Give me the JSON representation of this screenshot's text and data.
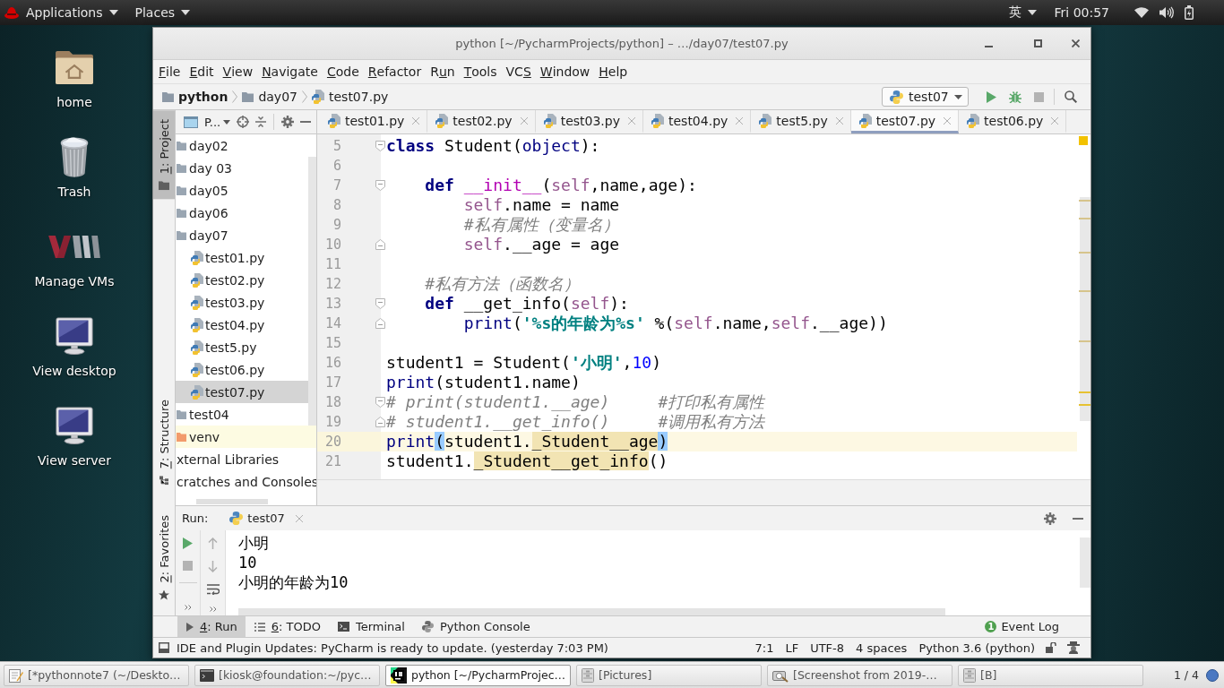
{
  "top_bar": {
    "menus": [
      "Applications",
      "Places"
    ],
    "input_method": "英",
    "clock": "Fri 00:57"
  },
  "desktop_icons": [
    {
      "label": "home",
      "kind": "home"
    },
    {
      "label": "Trash",
      "kind": "trash"
    },
    {
      "label": "Manage VMs",
      "kind": "vm"
    },
    {
      "label": "View desktop",
      "kind": "monitor"
    },
    {
      "label": "View server",
      "kind": "monitor"
    }
  ],
  "window": {
    "title": "python [~/PycharmProjects/python] – …/day07/test07.py",
    "menu": [
      {
        "mnemonic": "F",
        "rest": "ile"
      },
      {
        "mnemonic": "E",
        "rest": "dit"
      },
      {
        "mnemonic": "V",
        "rest": "iew"
      },
      {
        "mnemonic": "N",
        "rest": "avigate"
      },
      {
        "mnemonic": "C",
        "rest": "ode"
      },
      {
        "mnemonic": "R",
        "rest": "efactor"
      },
      {
        "lead": "R",
        "mnemonic": "u",
        "rest": "n"
      },
      {
        "mnemonic": "T",
        "rest": "ools"
      },
      {
        "lead": "VC",
        "mnemonic": "S"
      },
      {
        "mnemonic": "W",
        "rest": "indow"
      },
      {
        "mnemonic": "H",
        "rest": "elp"
      }
    ],
    "breadcrumbs": [
      {
        "label": "python",
        "kind": "project_root"
      },
      {
        "label": "day07",
        "kind": "folder"
      },
      {
        "label": "test07.py",
        "kind": "python_file"
      }
    ],
    "run_config": "test07",
    "tool_windows_left": [
      {
        "mnemonic": "1",
        "rest": ": Project",
        "kind": "project",
        "selected": true
      },
      {
        "mnemonic": "7",
        "rest": ": Structure",
        "kind": "structure",
        "selected": false
      },
      {
        "mnemonic": "2",
        "rest": ": Favorites",
        "kind": "favorites",
        "selected": false
      }
    ],
    "project_panel": {
      "view": "P...",
      "tree": [
        {
          "label": "day02",
          "kind": "folder",
          "selected": false
        },
        {
          "label": "day 03",
          "kind": "folder",
          "selected": false
        },
        {
          "label": "day05",
          "kind": "folder",
          "selected": false
        },
        {
          "label": "day06",
          "kind": "folder",
          "selected": false
        },
        {
          "label": "day07",
          "kind": "folder",
          "selected": false,
          "children": [
            {
              "label": "test01.py",
              "kind": "python_file",
              "selected": false
            },
            {
              "label": "test02.py",
              "kind": "python_file",
              "selected": false
            },
            {
              "label": "test03.py",
              "kind": "python_file",
              "selected": false
            },
            {
              "label": "test04.py",
              "kind": "python_file",
              "selected": false
            },
            {
              "label": "test5.py",
              "kind": "python_file",
              "selected": false
            },
            {
              "label": "test06.py",
              "kind": "python_file",
              "selected": false
            },
            {
              "label": "test07.py",
              "kind": "python_file",
              "selected": true
            }
          ]
        },
        {
          "label": "test04",
          "kind": "folder",
          "selected": false
        },
        {
          "label": "venv",
          "kind": "excluded_folder",
          "selected": false
        },
        {
          "label": "xternal Libraries",
          "kind": "library",
          "selected": false
        },
        {
          "label": "cratches and Consoles",
          "kind": "scratches",
          "selected": false
        }
      ]
    },
    "editor_tabs": [
      {
        "label": "test01.py",
        "selected": false
      },
      {
        "label": "test02.py",
        "selected": false
      },
      {
        "label": "test03.py",
        "selected": false
      },
      {
        "label": "test04.py",
        "selected": false
      },
      {
        "label": "test5.py",
        "selected": false
      },
      {
        "label": "test07.py",
        "selected": true
      },
      {
        "label": "test06.py",
        "selected": false
      }
    ],
    "code_lines": [
      {
        "number": "5",
        "current": false,
        "kind": "fold_start",
        "tokens": [
          {
            "kind": "keyword",
            "text": "class"
          },
          {
            "kind": "plain",
            "text": " Student("
          },
          {
            "kind": "builtin",
            "text": "object"
          },
          {
            "kind": "plain",
            "text": "):"
          }
        ]
      },
      {
        "number": "6",
        "current": false,
        "kind": "plain"
      },
      {
        "number": "7",
        "current": false,
        "kind": "fold_start",
        "tokens": [
          {
            "kind": "keyword",
            "text": "    def"
          },
          {
            "kind": "magic",
            "text": " __init__"
          },
          {
            "kind": "plain",
            "text": "("
          },
          {
            "kind": "self",
            "text": "self"
          },
          {
            "kind": "plain",
            "text": ",name,age):"
          }
        ]
      },
      {
        "number": "8",
        "current": false,
        "kind": "plain",
        "tokens": [
          {
            "kind": "self",
            "text": "        self"
          },
          {
            "kind": "plain",
            "text": ".name = name"
          }
        ]
      },
      {
        "number": "9",
        "current": false,
        "kind": "plain",
        "tokens": [
          {
            "kind": "comment",
            "text": "        #私有属性（变量名）"
          }
        ]
      },
      {
        "number": "10",
        "current": false,
        "kind": "fold_end",
        "tokens": [
          {
            "kind": "self",
            "text": "        self"
          },
          {
            "kind": "plain",
            "text": ".__age = age"
          }
        ]
      },
      {
        "number": "11",
        "current": false,
        "kind": "plain"
      },
      {
        "number": "12",
        "current": false,
        "kind": "plain",
        "tokens": [
          {
            "kind": "comment",
            "text": "    #私有方法（函数名）"
          }
        ]
      },
      {
        "number": "13",
        "current": false,
        "kind": "fold_start",
        "tokens": [
          {
            "kind": "keyword",
            "text": "    def"
          },
          {
            "kind": "plain",
            "text": " __get_info("
          },
          {
            "kind": "self",
            "text": "self"
          },
          {
            "kind": "plain",
            "text": "):"
          }
        ]
      },
      {
        "number": "14",
        "current": false,
        "kind": "fold_end",
        "tokens": [
          {
            "kind": "builtin",
            "text": "        print"
          },
          {
            "kind": "plain",
            "text": "("
          },
          {
            "kind": "string",
            "text": "'%s的年龄为%s'"
          },
          {
            "kind": "plain",
            "text": " %("
          },
          {
            "kind": "self",
            "text": "self"
          },
          {
            "kind": "plain",
            "text": ".name,"
          },
          {
            "kind": "self",
            "text": "self"
          },
          {
            "kind": "plain",
            "text": ".__age))"
          }
        ]
      },
      {
        "number": "15",
        "current": false,
        "kind": "plain"
      },
      {
        "number": "16",
        "current": false,
        "kind": "plain",
        "tokens": [
          {
            "kind": "plain",
            "text": "student1 = Student("
          },
          {
            "kind": "string",
            "text": "'小明'"
          },
          {
            "kind": "plain",
            "text": ","
          },
          {
            "kind": "number",
            "text": "10"
          },
          {
            "kind": "plain",
            "text": ")"
          }
        ]
      },
      {
        "number": "17",
        "current": false,
        "kind": "plain",
        "tokens": [
          {
            "kind": "builtin",
            "text": "print"
          },
          {
            "kind": "plain",
            "text": "(student1.name)"
          }
        ]
      },
      {
        "number": "18",
        "current": false,
        "kind": "fold_start",
        "tokens": [
          {
            "kind": "comment",
            "text": "# print(student1.__age)     #打印私有属性"
          }
        ]
      },
      {
        "number": "19",
        "current": false,
        "kind": "fold_end",
        "tokens": [
          {
            "kind": "comment",
            "text": "# student1.__get_info()     #调用私有方法"
          }
        ]
      },
      {
        "number": "20",
        "current": true,
        "kind": "plain",
        "tokens": [
          {
            "kind": "builtin",
            "text": "print"
          },
          {
            "kind": "brace",
            "text": "("
          },
          {
            "kind": "plain",
            "text": "student1."
          },
          {
            "kind": "usage",
            "text": "_Student__age"
          },
          {
            "kind": "brace",
            "text": ")"
          }
        ]
      },
      {
        "number": "21",
        "current": false,
        "kind": "plain",
        "tokens": [
          {
            "kind": "plain",
            "text": "student1."
          },
          {
            "kind": "usage",
            "text": "_Student__get_info"
          },
          {
            "kind": "plain",
            "text": "()"
          }
        ]
      }
    ],
    "run_panel": {
      "title": "Run:",
      "tab": "test07",
      "output": [
        "小明",
        "10",
        "小明的年龄为10"
      ]
    },
    "bottom_tools": [
      {
        "mnemonic": "4",
        "rest": ": Run",
        "kind": "run",
        "selected": true
      },
      {
        "mnemonic": "6",
        "rest": ": TODO",
        "kind": "todo",
        "selected": false
      },
      {
        "lead": "Terminal",
        "kind": "terminal",
        "selected": false
      },
      {
        "lead": "Python Console",
        "kind": "console",
        "selected": false
      }
    ],
    "event_log": {
      "badge": "1",
      "label": "Event Log"
    },
    "status_bar": {
      "message": "IDE and Plugin Updates: PyCharm is ready to update. (yesterday 7:03 PM)",
      "fields": [
        "7:1",
        "LF",
        "UTF-8",
        "4 spaces",
        "Python 3.6 (python)"
      ]
    }
  },
  "taskbar": {
    "items": [
      {
        "label": "[*pythonnote7 (~/Deskto…",
        "kind": "editor",
        "selected": false
      },
      {
        "label": "[kiosk@foundation:~/pyc…",
        "kind": "terminal",
        "selected": false
      },
      {
        "label": "python [~/PycharmProjec…",
        "kind": "ide",
        "selected": true
      },
      {
        "label": "[Pictures]",
        "kind": "files",
        "selected": false
      },
      {
        "label": "[Screenshot from 2019-…",
        "kind": "screenshot",
        "selected": false
      },
      {
        "label": "[B]",
        "kind": "files",
        "selected": false
      }
    ],
    "workspace": "1 / 4"
  }
}
